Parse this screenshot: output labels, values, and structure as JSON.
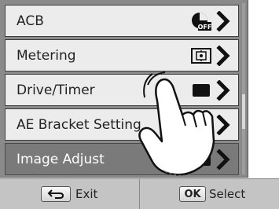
{
  "menu": {
    "items": [
      {
        "label": "ACB",
        "icon": "acb-off-icon",
        "selected": false
      },
      {
        "label": "Metering",
        "icon": "metering-icon",
        "selected": false
      },
      {
        "label": "Drive/Timer",
        "icon": "single-shot-icon",
        "selected": false
      },
      {
        "label": "AE Bracket Setting",
        "icon": "ae-bracket-icon",
        "selected": false
      },
      {
        "label": "Image Adjust",
        "icon": "image-adjust-icon",
        "selected": true
      }
    ],
    "acb_icon_text": "OFF"
  },
  "bottom_bar": {
    "back_key_icon": "return-arrow-icon",
    "exit_label": "Exit",
    "ok_key": "OK",
    "select_label": "Select"
  },
  "overlay": {
    "gesture_icon": "tap-hand-icon"
  }
}
